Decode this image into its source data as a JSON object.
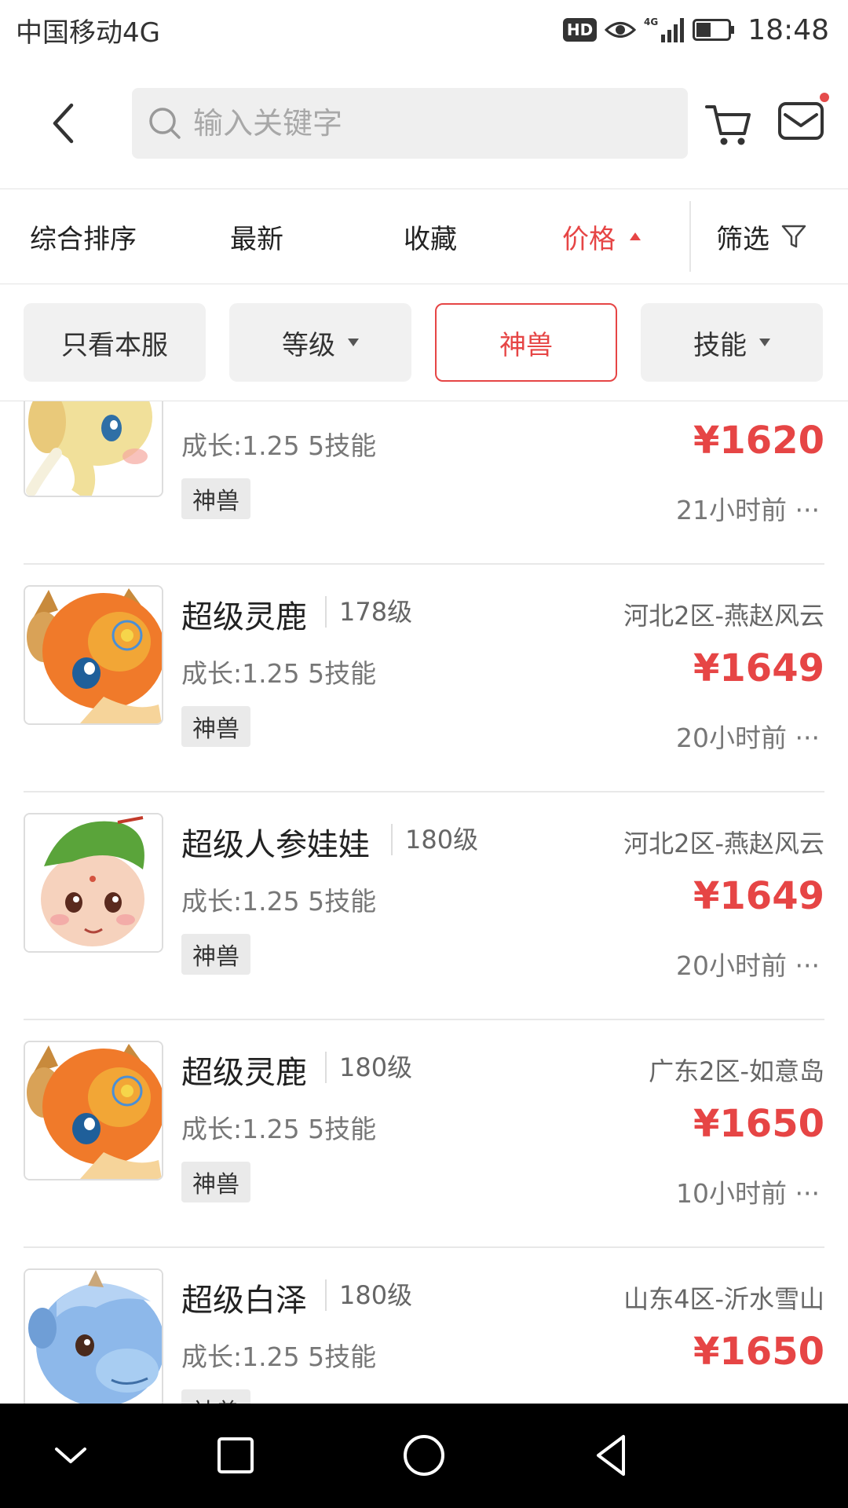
{
  "status_bar": {
    "carrier": "中国移动4G",
    "hd": "HD",
    "network": "4G",
    "time": "18:48"
  },
  "header": {
    "search_placeholder": "输入关键字",
    "back_icon": "chevron-left-icon",
    "cart_icon": "cart-icon",
    "mail_icon": "mail-icon",
    "accent": "#e64545"
  },
  "sort_tabs": [
    {
      "label": "综合排序"
    },
    {
      "label": "最新"
    },
    {
      "label": "收藏"
    },
    {
      "label": "价格",
      "active": true,
      "sort": "ascending"
    }
  ],
  "filter_label": "筛选",
  "chips": [
    {
      "label": "只看本服"
    },
    {
      "label": "等级",
      "dropdown": true
    },
    {
      "label": "神兽",
      "selected": true
    },
    {
      "label": "技能",
      "dropdown": true
    }
  ],
  "items": [
    {
      "name": "",
      "level": "",
      "server": "",
      "attr": "成长:1.25 5技能",
      "price": "¥1620",
      "tag": "神兽",
      "time": "21小时前 ···",
      "image": "elephant"
    },
    {
      "name": "超级灵鹿",
      "level": "178级",
      "server": "河北2区-燕赵风云",
      "attr": "成长:1.25 5技能",
      "price": "¥1649",
      "tag": "神兽",
      "time": "20小时前 ···",
      "image": "deer"
    },
    {
      "name": "超级人参娃娃",
      "level": "180级",
      "server": "河北2区-燕赵风云",
      "attr": "成长:1.25 5技能",
      "price": "¥1649",
      "tag": "神兽",
      "time": "20小时前 ···",
      "image": "ginseng-baby"
    },
    {
      "name": "超级灵鹿",
      "level": "180级",
      "server": "广东2区-如意岛",
      "attr": "成长:1.25 5技能",
      "price": "¥1650",
      "tag": "神兽",
      "time": "10小时前 ···",
      "image": "deer"
    },
    {
      "name": "超级白泽",
      "level": "180级",
      "server": "山东4区-沂水雪山",
      "attr": "成长:1.25 5技能",
      "price": "¥1650",
      "tag": "神兽",
      "time": "",
      "image": "baize"
    }
  ],
  "nav_bar": {
    "icons": [
      "collapse-icon",
      "recents-icon",
      "home-icon",
      "back-icon"
    ]
  }
}
